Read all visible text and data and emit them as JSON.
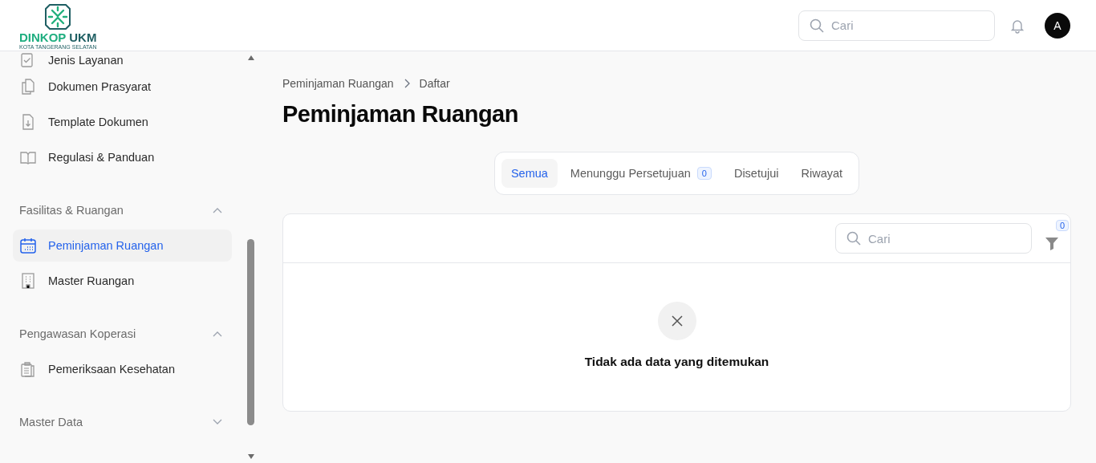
{
  "header": {
    "logo": {
      "name_part_1": "DINKOP",
      "name_part_2": "UKM",
      "subtitle": "KOTA TANGERANG SELATAN"
    },
    "search": {
      "placeholder": "Cari"
    },
    "avatar": "A"
  },
  "sidebar": {
    "items": [
      {
        "label": "Jenis Layanan",
        "selected": false
      },
      {
        "label": "Dokumen Prasyarat",
        "selected": false
      },
      {
        "label": "Template Dokumen",
        "selected": false
      },
      {
        "label": "Regulasi & Panduan",
        "selected": false
      }
    ],
    "sections": [
      {
        "label": "Fasilitas & Ruangan",
        "expanded": true,
        "items": [
          {
            "label": "Peminjaman Ruangan",
            "selected": true
          },
          {
            "label": "Master Ruangan",
            "selected": false
          }
        ]
      },
      {
        "label": "Pengawasan Koperasi",
        "expanded": true,
        "items": [
          {
            "label": "Pemeriksaan Kesehatan",
            "selected": false
          }
        ]
      },
      {
        "label": "Master Data",
        "expanded": false
      }
    ]
  },
  "breadcrumb": [
    "Peminjaman Ruangan",
    "Daftar"
  ],
  "title": "Peminjaman Ruangan",
  "tabs": [
    {
      "label": "Semua",
      "selected": true
    },
    {
      "label": "Menunggu Persetujuan",
      "selected": false,
      "badge": "0"
    },
    {
      "label": "Disetujui",
      "selected": false
    },
    {
      "label": "Riwayat",
      "selected": false
    }
  ],
  "table": {
    "search": {
      "placeholder": "Cari"
    },
    "filter_count": "0",
    "empty_message": "Tidak ada data yang ditemukan"
  }
}
